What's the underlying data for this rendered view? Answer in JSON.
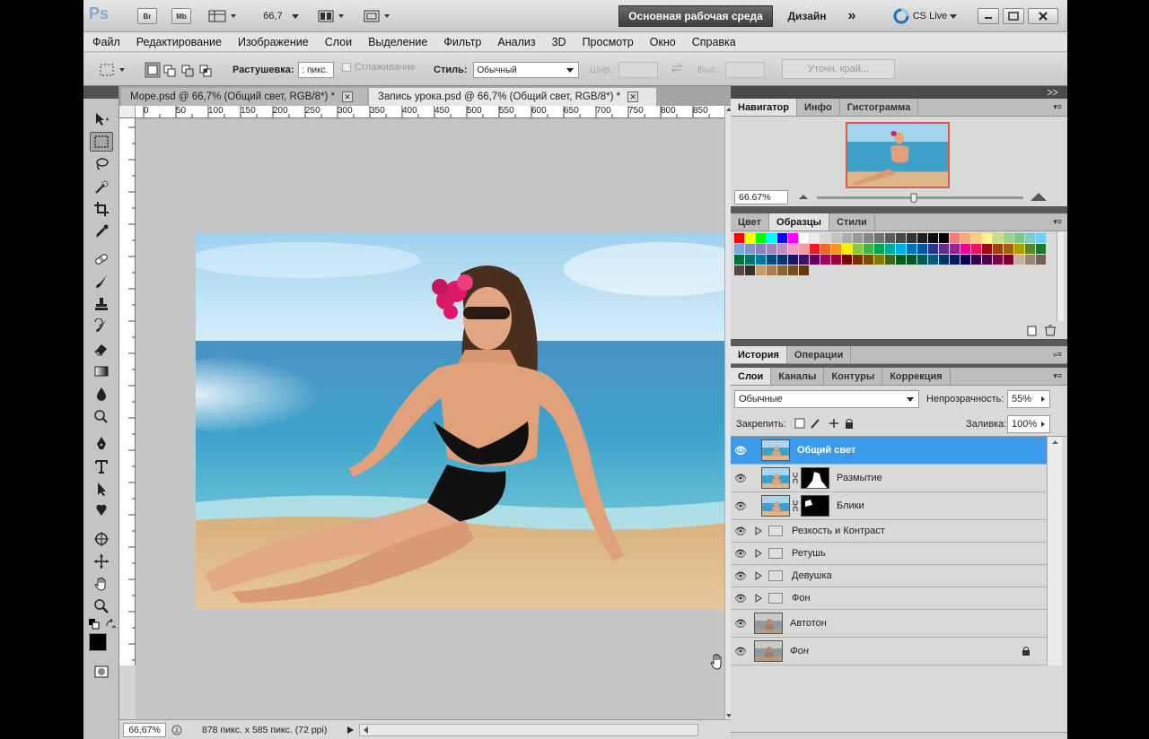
{
  "topbar": {
    "logo": "Ps",
    "br": "Br",
    "mb": "Mb",
    "zoom": "66,7",
    "workspace": "Основная рабочая среда",
    "design": "Дизайн",
    "more": "»",
    "cslive": "CS Live"
  },
  "menu": [
    "Файл",
    "Редактирование",
    "Изображение",
    "Слои",
    "Выделение",
    "Фильтр",
    "Анализ",
    "3D",
    "Просмотр",
    "Окно",
    "Справка"
  ],
  "options": {
    "feather_label": "Растушевка:",
    "feather_value": ": пикс.",
    "antialias": "Сглаживание",
    "style_label": "Стиль:",
    "style_value": "Обычный",
    "width_label": "Шир.:",
    "height_label": "Выс.:",
    "refine": "Уточн. край..."
  },
  "tabs": [
    {
      "label": "Море.psd @ 66,7% (Общий свет, RGB/8*) *"
    },
    {
      "label": "Запись урока.psd @ 66,7% (Общий свет, RGB/8*) *"
    }
  ],
  "ruler": [
    "0",
    "50",
    "100",
    "150",
    "200",
    "250",
    "300",
    "350",
    "400",
    "450",
    "500",
    "550",
    "600",
    "650",
    "700",
    "750",
    "800",
    "850"
  ],
  "status": {
    "zoom": "66,67%",
    "info": "878 пикс. x 585 пикс. (72 ppi)"
  },
  "navigator": {
    "tabs": [
      "Навигатор",
      "Инфо",
      "Гистограмма"
    ],
    "zoom": "66.67%"
  },
  "swatches": {
    "tabs": [
      "Цвет",
      "Образцы",
      "Стили"
    ],
    "row1": [
      "#ff0000",
      "#ffff00",
      "#00ff00",
      "#00ffff",
      "#0000ff",
      "#ff00ff",
      "#ffffff",
      "#ebebeb",
      "#d6d6d6",
      "#c2c2c2",
      "#adadad",
      "#999999",
      "#858585",
      "#707070",
      "#5c5c5c",
      "#474747",
      "#333333",
      "#1f1f1f",
      "#0a0a0a",
      "#000000"
    ],
    "colors": [
      "#f07c7c",
      "#f5a97a",
      "#f8cd7e",
      "#fff48e",
      "#c4df8b",
      "#9dd08c",
      "#7dc88f",
      "#7accc8",
      "#6dcff6",
      "#79a9d9",
      "#8493ca",
      "#8882bd",
      "#a185bd",
      "#bc8dbf",
      "#f49bc1",
      "#f5999d",
      "#ed1c24",
      "#f26522",
      "#f7941d",
      "#fff200",
      "#8dc63f",
      "#39b54a",
      "#00a651",
      "#00a99d",
      "#00aeef",
      "#0072bc",
      "#0054a6",
      "#2e3192",
      "#662d91",
      "#92278f",
      "#ec008c",
      "#ed145b",
      "#9e0b0f",
      "#a0410d",
      "#a36209",
      "#aba000",
      "#598527",
      "#197b30",
      "#007236",
      "#00746b",
      "#0076a3",
      "#004a80",
      "#003471",
      "#1b1464",
      "#440e62",
      "#630460",
      "#9e005d",
      "#9e0039",
      "#790000",
      "#7b2e00",
      "#7d4900",
      "#827b00",
      "#406618",
      "#005e20",
      "#005826",
      "#005952",
      "#005b7f",
      "#003663",
      "#002157",
      "#0d004c",
      "#32004b",
      "#4b0049",
      "#7b0046",
      "#7a0026",
      "#c7b299",
      "#998675",
      "#736357",
      "#534741",
      "#37302d",
      "#c69c6d",
      "#a67c52",
      "#8c6239",
      "#754c24",
      "#603913"
    ]
  },
  "history": {
    "tabs": [
      "История",
      "Операции"
    ]
  },
  "layers": {
    "tabs": [
      "Слои",
      "Каналы",
      "Контуры",
      "Коррекция"
    ],
    "blend": "Обычные",
    "opacity_label": "Непрозрачность:",
    "opacity": "55%",
    "lock_label": "Закрепить:",
    "fill_label": "Заливка:",
    "fill": "100%",
    "items": [
      {
        "name": "Общий свет",
        "type": "image"
      },
      {
        "name": "Размытие",
        "type": "masked"
      },
      {
        "name": "Блики",
        "type": "masked"
      },
      {
        "name": "Резкость и Контраст",
        "type": "group"
      },
      {
        "name": "Ретушь",
        "type": "group"
      },
      {
        "name": "Девушка",
        "type": "group"
      },
      {
        "name": "Фон",
        "type": "group"
      },
      {
        "name": "Автотон",
        "type": "image"
      },
      {
        "name": "Фон",
        "type": "background"
      }
    ]
  }
}
